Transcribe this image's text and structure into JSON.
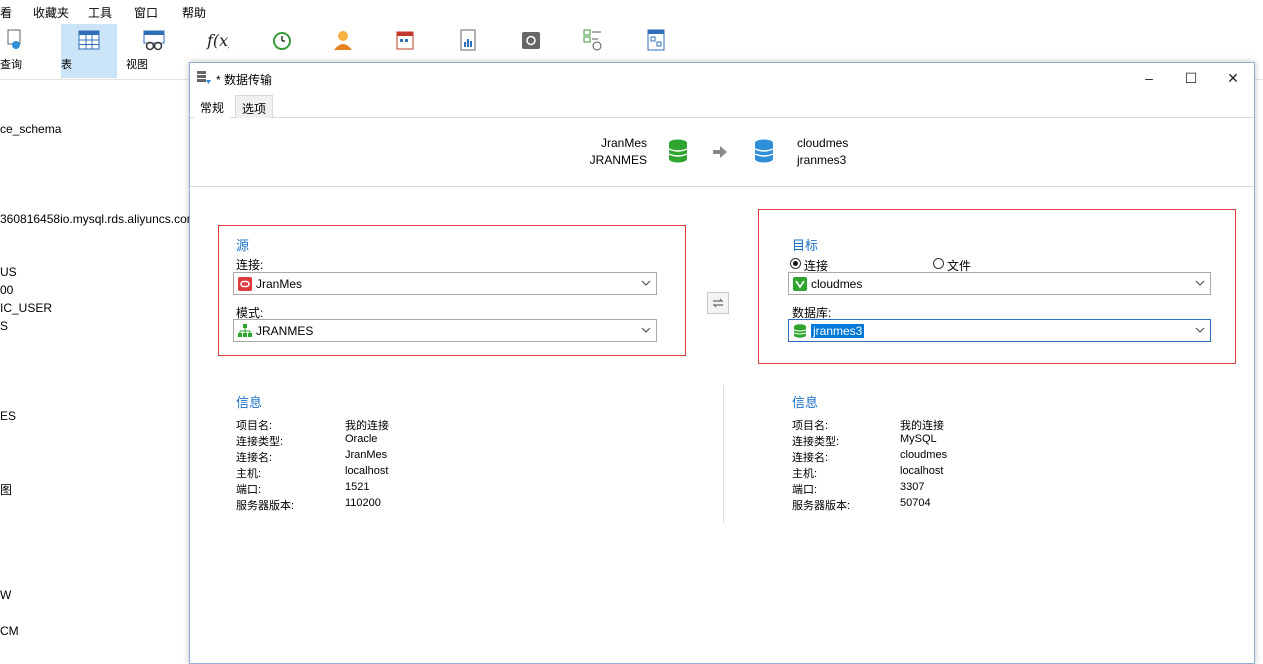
{
  "menubar": {
    "items": [
      "看",
      "收藏夹",
      "工具",
      "窗口",
      "帮助"
    ]
  },
  "toolbar": {
    "query_label": "查询",
    "table_label": "表",
    "view_label": "视图",
    "icons": [
      "query-icon",
      "table-icon",
      "view-icon",
      "function-icon",
      "event-icon",
      "user-icon",
      "other-icon",
      "report-icon",
      "backup-icon",
      "schedule-icon",
      "model-icon"
    ]
  },
  "tree": {
    "items": [
      "ce_schema",
      "360816458io.mysql.rds.aliyuncs.com",
      "US",
      "00",
      "IC_USER",
      "S",
      "ES",
      "图",
      "W",
      "CM"
    ]
  },
  "dialog": {
    "title": "* 数据传输",
    "tabs": [
      "常规",
      "选项"
    ],
    "header": {
      "source_conn": "JranMes",
      "source_schema": "JRANMES",
      "target_conn": "cloudmes",
      "target_db": "jranmes3"
    },
    "source": {
      "title": "源",
      "conn_label": "连接:",
      "conn_value": "JranMes",
      "schema_label": "模式:",
      "schema_value": "JRANMES"
    },
    "target": {
      "title": "目标",
      "radio_conn": "连接",
      "radio_file": "文件",
      "conn_value": "cloudmes",
      "db_label": "数据库:",
      "db_value": "jranmes3"
    },
    "source_info": {
      "title": "信息",
      "rows": [
        [
          "项目名:",
          "我的连接"
        ],
        [
          "连接类型:",
          "Oracle"
        ],
        [
          "连接名:",
          "JranMes"
        ],
        [
          "主机:",
          "localhost"
        ],
        [
          "端口:",
          "1521"
        ],
        [
          "服务器版本:",
          "110200"
        ]
      ]
    },
    "target_info": {
      "title": "信息",
      "rows": [
        [
          "项目名:",
          "我的连接"
        ],
        [
          "连接类型:",
          "MySQL"
        ],
        [
          "连接名:",
          "cloudmes"
        ],
        [
          "主机:",
          "localhost"
        ],
        [
          "端口:",
          "3307"
        ],
        [
          "服务器版本:",
          "50704"
        ]
      ]
    }
  },
  "colors": {
    "accent": "#1a6fc9",
    "highlight_border": "#e0393e",
    "selection": "#0078d7",
    "db_green": "#2ea52e",
    "db_blue": "#2f8ed8"
  }
}
